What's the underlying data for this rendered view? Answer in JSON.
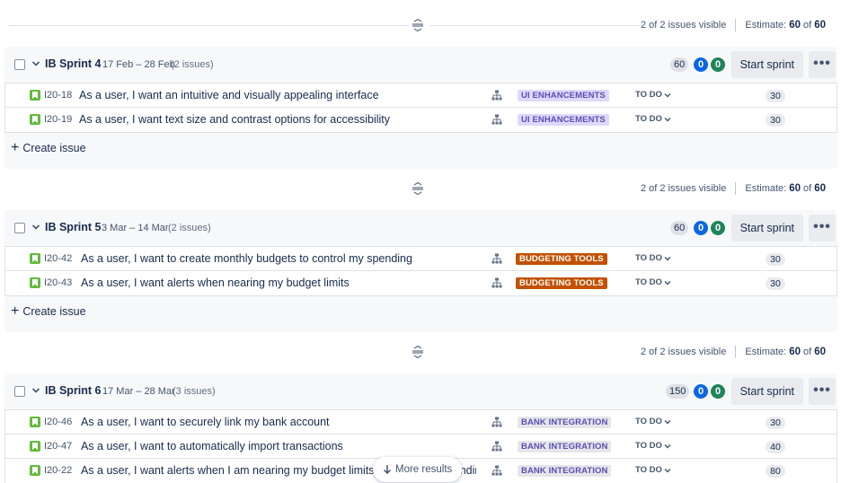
{
  "dividers": [
    {
      "visible_text": "2 of 2 issues visible",
      "estimate_label": "Estimate:",
      "estimate_value": "60",
      "of": "of",
      "estimate_total": "60"
    },
    {
      "visible_text": "2 of 2 issues visible",
      "estimate_label": "Estimate:",
      "estimate_value": "60",
      "of": "of",
      "estimate_total": "60"
    },
    {
      "visible_text": "2 of 2 issues visible",
      "estimate_label": "Estimate:",
      "estimate_value": "60",
      "of": "of",
      "estimate_total": "60"
    }
  ],
  "sprints": [
    {
      "name": "IB Sprint 4",
      "dates": "17 Feb – 28 Feb",
      "count": "(2 issues)",
      "points_total": "60",
      "points_progress": "0",
      "points_done": "0",
      "start_label": "Start sprint",
      "more_label": "•••",
      "issues": [
        {
          "key": "I20-18",
          "summary": "As a user, I want an intuitive and visually appealing interface",
          "epic": "UI ENHANCEMENTS",
          "status": "TO DO",
          "estimate": "30"
        },
        {
          "key": "I20-19",
          "summary": "As a user, I want text size and contrast options for accessibility",
          "epic": "UI ENHANCEMENTS",
          "status": "TO DO",
          "estimate": "30"
        }
      ],
      "create_label": "Create issue"
    },
    {
      "name": "IB Sprint 5",
      "dates": "3 Mar – 14 Mar",
      "count": "(2 issues)",
      "points_total": "60",
      "points_progress": "0",
      "points_done": "0",
      "start_label": "Start sprint",
      "more_label": "•••",
      "issues": [
        {
          "key": "I20-42",
          "summary": "As a user, I want to create monthly budgets to control my spending",
          "epic": "BUDGETING TOOLS",
          "status": "TO DO",
          "estimate": "30"
        },
        {
          "key": "I20-43",
          "summary": "As a user, I want alerts when nearing my budget limits",
          "epic": "BUDGETING TOOLS",
          "status": "TO DO",
          "estimate": "30"
        }
      ],
      "create_label": "Create issue"
    },
    {
      "name": "IB Sprint 6",
      "dates": "17 Mar – 28 Mar",
      "count": "(3 issues)",
      "points_total": "150",
      "points_progress": "0",
      "points_done": "0",
      "start_label": "Start sprint",
      "more_label": "•••",
      "issues": [
        {
          "key": "I20-46",
          "summary": "As a user, I want to securely link my bank account",
          "epic": "BANK INTEGRATION",
          "status": "TO DO",
          "estimate": "30"
        },
        {
          "key": "I20-47",
          "summary": "As a user, I want to automatically import transactions",
          "epic": "BANK INTEGRATION",
          "status": "TO DO",
          "estimate": "40"
        },
        {
          "key": "I20-22",
          "summary": "As a user, I want alerts when I am nearing my budget limits to avoid overspending.",
          "epic": "BANK INTEGRATION",
          "status": "TO DO",
          "estimate": "80"
        }
      ]
    }
  ],
  "more_results": "More results",
  "colors": {
    "story": "#63ba3c",
    "progress_badge": "#0c66e4",
    "done_badge": "#1f845a",
    "epic_purple_bg": "#dfd8fd",
    "epic_orange_bg": "#c25100"
  }
}
